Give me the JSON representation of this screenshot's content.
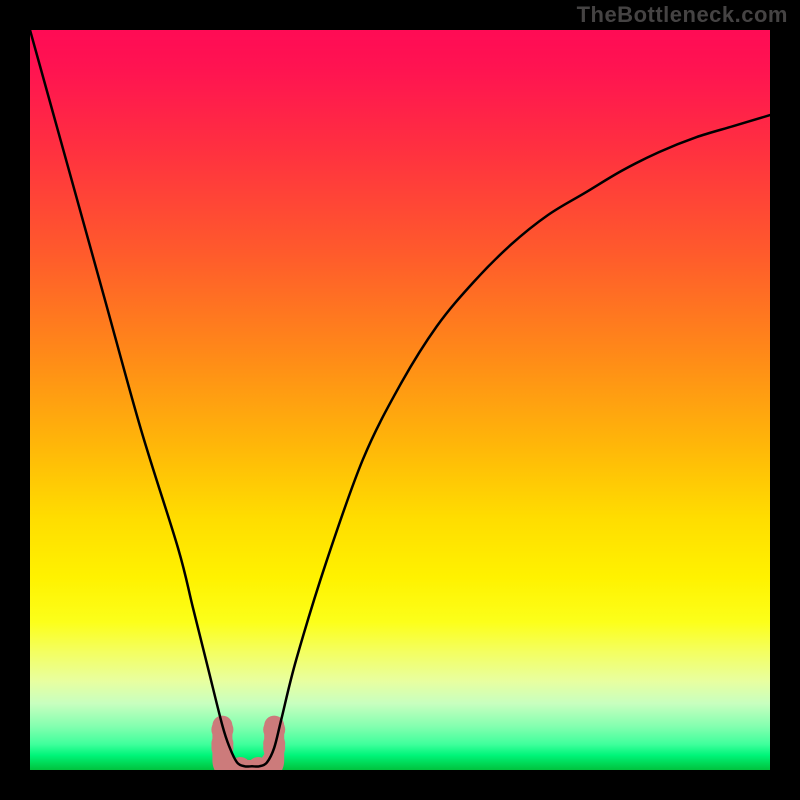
{
  "watermark": "TheBottleneck.com",
  "chart_data": {
    "type": "line",
    "title": "",
    "xlabel": "",
    "ylabel": "",
    "xlim": [
      0,
      100
    ],
    "ylim": [
      0,
      100
    ],
    "grid": false,
    "series": [
      {
        "name": "curve",
        "x": [
          0,
          5,
          10,
          15,
          20,
          22,
          24,
          26,
          27,
          28,
          29,
          30,
          31,
          32,
          33,
          34,
          36,
          40,
          45,
          50,
          55,
          60,
          65,
          70,
          75,
          80,
          85,
          90,
          95,
          100
        ],
        "values": [
          100,
          82,
          64,
          46,
          30,
          22,
          14,
          6,
          3,
          1,
          0.5,
          0.5,
          0.5,
          1,
          3,
          7,
          15,
          28,
          42,
          52,
          60,
          66,
          71,
          75,
          78,
          81,
          83.5,
          85.5,
          87,
          88.5
        ]
      }
    ],
    "floor_marker": {
      "shape": "u",
      "color": "#cc7b7b",
      "x_range": [
        26,
        33
      ],
      "y_range": [
        0,
        6
      ]
    },
    "background_gradient": {
      "type": "vertical",
      "stops": [
        {
          "pos": 0.0,
          "color": "#ff0b55"
        },
        {
          "pos": 0.3,
          "color": "#ff5a2c"
        },
        {
          "pos": 0.56,
          "color": "#ffb609"
        },
        {
          "pos": 0.74,
          "color": "#fff200"
        },
        {
          "pos": 0.88,
          "color": "#e8ffa0"
        },
        {
          "pos": 0.97,
          "color": "#40ff9c"
        },
        {
          "pos": 1.0,
          "color": "#00c23d"
        }
      ]
    }
  }
}
